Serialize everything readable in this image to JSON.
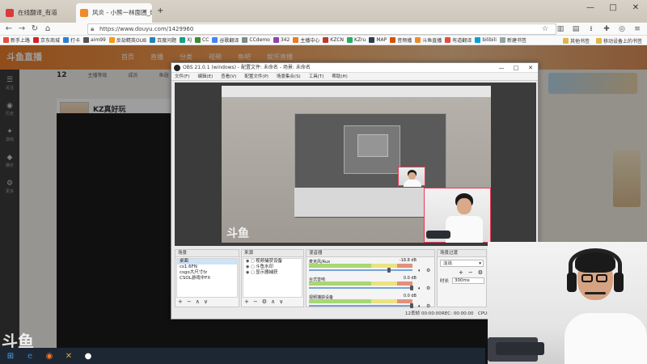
{
  "browser": {
    "tabs": [
      {
        "label": "在线翻译_有道",
        "color": "#d93a3a"
      },
      {
        "label": "风炎 - 小熊一林面团_炫炫精彩",
        "color": "#f08a2b"
      }
    ],
    "new_tab": "+",
    "window_controls": {
      "minimize": "—",
      "maximize": "□",
      "close": "✕"
    },
    "url": "https://www.douyu.com/1429960",
    "nav": {
      "back": "←",
      "forward": "→",
      "reload": "↻",
      "home": "⌂"
    },
    "bookmarks": [
      {
        "label": "新手上路",
        "color": "#e74c3c"
      },
      {
        "label": "京东商城",
        "color": "#d3222a"
      },
      {
        "label": "打卡",
        "color": "#2d7fd3"
      },
      {
        "label": "aim99",
        "color": "#555555"
      },
      {
        "label": "反劫精英OUB",
        "color": "#f39c12"
      },
      {
        "label": "百度问题",
        "color": "#2980b9"
      },
      {
        "label": "XJ",
        "color": "#16a085"
      },
      {
        "label": "CC",
        "color": "#3c8d2f"
      },
      {
        "label": "谷歌翻译",
        "color": "#4285f4"
      },
      {
        "label": "CCdemo",
        "color": "#7f8c8d"
      },
      {
        "label": "342",
        "color": "#8e44ad"
      },
      {
        "label": "主播中心",
        "color": "#e67e22"
      },
      {
        "label": "KZCN",
        "color": "#c0392b"
      },
      {
        "label": "KZru",
        "color": "#27ae60"
      },
      {
        "label": "MAP",
        "color": "#2c3e50"
      },
      {
        "label": "音频播",
        "color": "#d35400"
      },
      {
        "label": "斗鱼直播",
        "color": "#f08a2b"
      },
      {
        "label": "有道翻译",
        "color": "#e74c3c"
      },
      {
        "label": "bilibili",
        "color": "#00a1d6"
      },
      {
        "label": "新建书签",
        "color": "#95a5a6"
      }
    ],
    "bookmarks_right": [
      "其他书签",
      "移动设备上的书签"
    ]
  },
  "page": {
    "logo": "斗鱼直播",
    "nav": [
      "首页",
      "直播",
      "分类",
      "视频",
      "鱼吧",
      "娱乐直播"
    ],
    "room_title": "KZ真好玩",
    "room_stats": [
      "12",
      "主播等级",
      "成员",
      "鱼翅"
    ],
    "rail": [
      {
        "icon": "☰",
        "label": "关注"
      },
      {
        "icon": "◉",
        "label": "历史"
      },
      {
        "icon": "✦",
        "label": "游戏"
      },
      {
        "icon": "◆",
        "label": "娱乐"
      },
      {
        "icon": "⚙",
        "label": "更多"
      }
    ],
    "watermark": "斗鱼"
  },
  "obs": {
    "title": "OBS 21.0.1 (windows) - 配置文件: 未命名 - 场景: 未命名",
    "menu": [
      "文件(F)",
      "编辑(E)",
      "查看(V)",
      "配置文件(P)",
      "场景集合(S)",
      "工具(T)",
      "帮助(H)"
    ],
    "watermark": "斗鱼",
    "scenes": {
      "title": "场景",
      "items": [
        "桌面",
        "cs1.6FN",
        "csgo大尺寸fz",
        "CSOL游戏中FX"
      ],
      "selected": 0
    },
    "sources": {
      "title": "来源",
      "items": [
        "视频捕获设备",
        "斗鱼水印",
        "显示器捕获"
      ]
    },
    "mixer": {
      "title": "混音器",
      "channels": [
        {
          "name": "麦克风/Aux",
          "db": "-18.8 dB"
        },
        {
          "name": "台式音响",
          "db": "0.0 dB"
        },
        {
          "name": "视频捕获设备",
          "db": "0.0 dB"
        }
      ]
    },
    "transitions": {
      "title": "场景过渡",
      "type": "淡出",
      "duration_label": "时长",
      "duration": "300ms"
    },
    "footer_buttons": [
      "+",
      "−",
      "∧",
      "∨"
    ],
    "status": {
      "dropped": "12丢帧",
      "live": "00:00:00",
      "rec": "REC: 00:00:00",
      "cpu": "CPU: 4.1"
    }
  },
  "taskbar": {
    "items": [
      {
        "icon": "⊞",
        "color": "#4aa3f0"
      },
      {
        "icon": "e",
        "color": "#2d8ad8"
      },
      {
        "icon": "◉",
        "color": "#f0772b"
      },
      {
        "icon": "✕",
        "color": "#e0a83a"
      },
      {
        "icon": "●",
        "color": "#ffffff"
      }
    ]
  }
}
